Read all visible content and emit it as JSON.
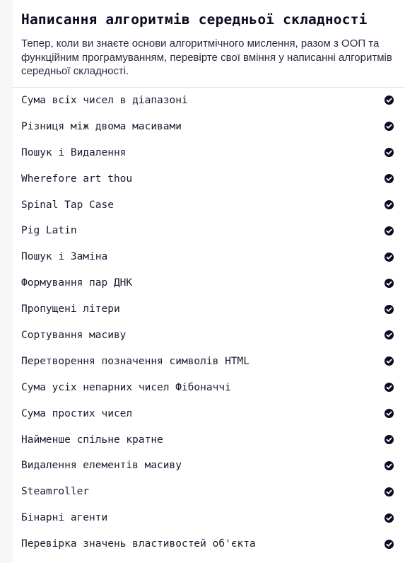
{
  "section": {
    "title": "Написання алгоритмів середньої складності",
    "description": "Тепер, коли ви знаєте основи алгоритмічного мислення, разом з ООП та функційним програмуванням, перевірте свої вміння у написанні алгоритмів середньої складності."
  },
  "challenges": [
    {
      "label": "Сума всіх чисел в діапазоні",
      "completed": true,
      "icon": "check-circle-icon"
    },
    {
      "label": "Різниця між двома масивами",
      "completed": true,
      "icon": "check-circle-icon"
    },
    {
      "label": "Пошук і Видалення",
      "completed": true,
      "icon": "check-circle-icon"
    },
    {
      "label": "Wherefore art thou",
      "completed": true,
      "icon": "check-circle-icon"
    },
    {
      "label": "Spinal Tap Case",
      "completed": true,
      "icon": "check-circle-icon"
    },
    {
      "label": "Pig Latin",
      "completed": true,
      "icon": "check-circle-icon"
    },
    {
      "label": "Пошук і Заміна",
      "completed": true,
      "icon": "check-circle-icon"
    },
    {
      "label": "Формування пар ДНК",
      "completed": true,
      "icon": "check-circle-icon"
    },
    {
      "label": "Пропущені літери",
      "completed": true,
      "icon": "check-circle-icon"
    },
    {
      "label": "Сортування масиву",
      "completed": true,
      "icon": "check-circle-icon"
    },
    {
      "label": "Перетворення позначення символів HTML",
      "completed": true,
      "icon": "check-circle-icon"
    },
    {
      "label": "Сума усіх непарних чисел Фібоначчі",
      "completed": true,
      "icon": "check-circle-icon"
    },
    {
      "label": "Сума простих чисел",
      "completed": true,
      "icon": "check-circle-icon"
    },
    {
      "label": "Найменше спільне кратне",
      "completed": true,
      "icon": "check-circle-icon"
    },
    {
      "label": "Видалення елементів масиву",
      "completed": true,
      "icon": "check-circle-icon"
    },
    {
      "label": "Steamroller",
      "completed": true,
      "icon": "check-circle-icon"
    },
    {
      "label": "Бінарні агенти",
      "completed": true,
      "icon": "check-circle-icon"
    },
    {
      "label": "Перевірка значень властивостей об'єкта",
      "completed": true,
      "icon": "check-circle-icon"
    }
  ],
  "colors": {
    "background": "#f5f6f7",
    "panel": "#ffffff",
    "text": "#0a0a23",
    "check": "#0a0a23"
  }
}
